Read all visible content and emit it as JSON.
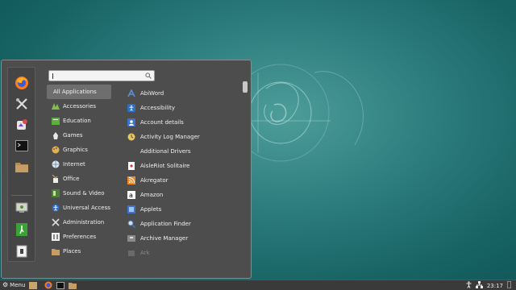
{
  "search": {
    "value": "",
    "placeholder": ""
  },
  "favorites": [
    {
      "name": "firefox"
    },
    {
      "name": "system-settings"
    },
    {
      "name": "software-manager"
    },
    {
      "name": "terminal"
    },
    {
      "name": "files"
    },
    {
      "name": "lock-screen"
    },
    {
      "name": "logout"
    },
    {
      "name": "quit"
    }
  ],
  "categories": [
    {
      "label": "All Applications",
      "icon": "none"
    },
    {
      "label": "Accessories",
      "icon": "accessories-icon"
    },
    {
      "label": "Education",
      "icon": "education-icon"
    },
    {
      "label": "Games",
      "icon": "games-icon"
    },
    {
      "label": "Graphics",
      "icon": "graphics-icon"
    },
    {
      "label": "Internet",
      "icon": "internet-icon"
    },
    {
      "label": "Office",
      "icon": "office-icon"
    },
    {
      "label": "Sound & Video",
      "icon": "sound-video-icon"
    },
    {
      "label": "Universal Access",
      "icon": "universal-access-icon"
    },
    {
      "label": "Administration",
      "icon": "administration-icon"
    },
    {
      "label": "Preferences",
      "icon": "preferences-icon"
    },
    {
      "label": "Places",
      "icon": "places-icon"
    }
  ],
  "apps": [
    {
      "label": "AbiWord",
      "icon": "abiword-icon"
    },
    {
      "label": "Accessibility",
      "icon": "accessibility-icon"
    },
    {
      "label": "Account details",
      "icon": "account-details-icon"
    },
    {
      "label": "Activity Log Manager",
      "icon": "activity-log-icon"
    },
    {
      "label": "Additional Drivers",
      "icon": "none"
    },
    {
      "label": "AisleRiot Solitaire",
      "icon": "solitaire-icon"
    },
    {
      "label": "Akregator",
      "icon": "akregator-icon"
    },
    {
      "label": "Amazon",
      "icon": "amazon-icon"
    },
    {
      "label": "Applets",
      "icon": "applets-icon"
    },
    {
      "label": "Application Finder",
      "icon": "app-finder-icon"
    },
    {
      "label": "Archive Manager",
      "icon": "archive-manager-icon"
    },
    {
      "label": "Ark",
      "icon": "ark-icon"
    }
  ],
  "taskbar": {
    "menu_label": "Menu",
    "clock": "23:17"
  },
  "colors": {
    "menu_bg": "#4d4d4d",
    "selected_bg": "#6e6e6e",
    "taskbar_bg": "#3a3a3a"
  }
}
